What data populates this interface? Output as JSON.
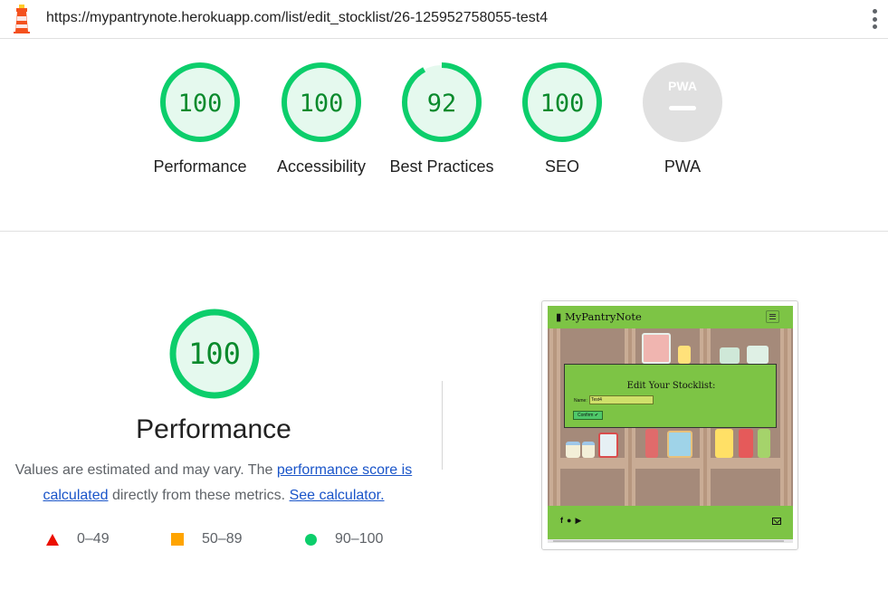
{
  "url_bar": {
    "url": "https://mypantrynote.herokuapp.com/list/edit_stocklist/26-125952758055-test4",
    "logo_icon": "lighthouse-icon",
    "menu_icon": "more-vert-icon"
  },
  "gauges": [
    {
      "label": "Performance",
      "score": "100",
      "value": 1.0
    },
    {
      "label": "Accessibility",
      "score": "100",
      "value": 1.0
    },
    {
      "label": "Best Practices",
      "score": "92",
      "value": 0.92
    },
    {
      "label": "SEO",
      "score": "100",
      "value": 1.0
    },
    {
      "label": "PWA",
      "score": "PWA",
      "value": null
    }
  ],
  "performance": {
    "score": "100",
    "title": "Performance",
    "desc_prefix": "Values are estimated and may vary. The ",
    "link_score": "performance score is calculated",
    "desc_middle": " directly from these metrics. ",
    "link_calc": "See calculator."
  },
  "legend": [
    {
      "shape": "triangle",
      "range": "0–49",
      "color": "#eb0f00"
    },
    {
      "shape": "square",
      "range": "50–89",
      "color": "#ffa400"
    },
    {
      "shape": "circle",
      "range": "90–100",
      "color": "#0cce6b"
    }
  ],
  "preview": {
    "brand": "MyPantryNote",
    "brand_icon": "clipboard-icon",
    "modal_title": "Edit Your Stocklist:",
    "name_label": "Name:",
    "name_value": "Test4",
    "confirm_label": "Confirm ✔",
    "social_icons": [
      "facebook-icon",
      "pinterest-icon",
      "youtube-icon"
    ],
    "mail_icon": "envelope-icon"
  },
  "colors": {
    "pass_green": "#0cce6b",
    "pass_fill": "#e5f9ee",
    "pass_text": "#0a8a2c",
    "pwa_grey": "#e0e0e0",
    "link_blue": "#1a55c9",
    "preview_green": "#7dc445"
  }
}
